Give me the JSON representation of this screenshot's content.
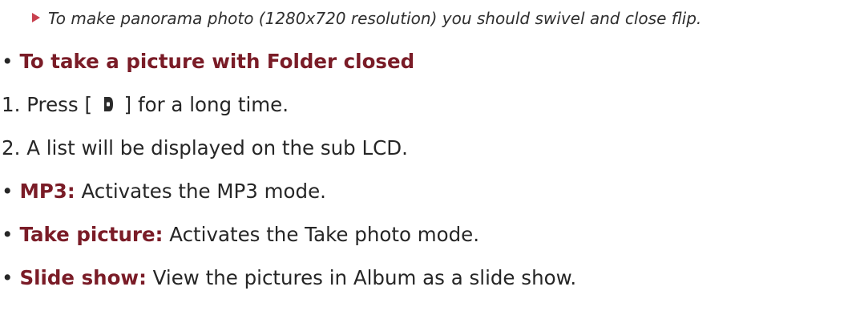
{
  "note": {
    "text": "To make panorama photo (1280x720 resolution) you should swivel and close flip."
  },
  "section": {
    "heading": "To take a picture with Folder closed"
  },
  "steps": [
    {
      "number": "1.",
      "before": "Press [",
      "icon": "camera-side-key-icon",
      "after": "] for a long time."
    },
    {
      "number": "2.",
      "text": "A list will be displayed on the sub LCD."
    }
  ],
  "options": [
    {
      "label": "MP3:",
      "desc": "Activates the MP3 mode."
    },
    {
      "label": "Take picture:",
      "desc": "Activates the Take photo mode."
    },
    {
      "label": "Slide show:",
      "desc": "View the pictures in Album as a slide show."
    }
  ],
  "colors": {
    "label": "#7a1c27",
    "note_marker": "#c8404f",
    "text": "#262626"
  }
}
